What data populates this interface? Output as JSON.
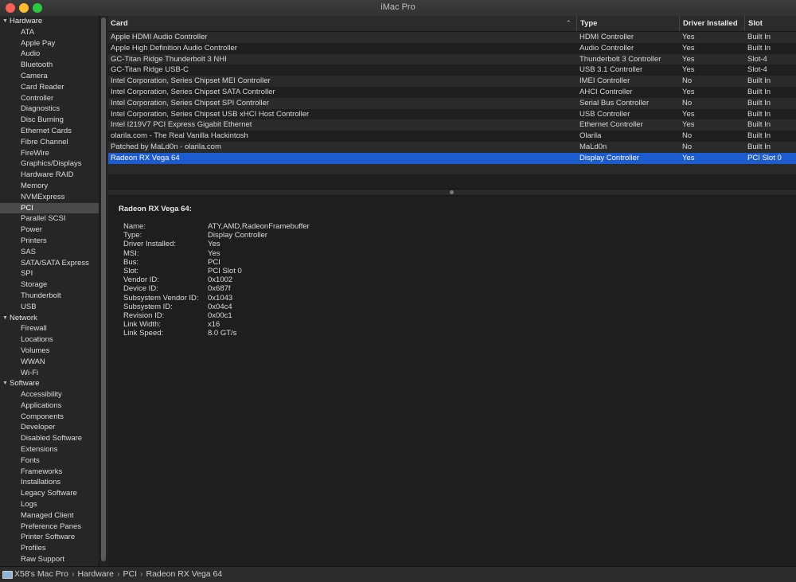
{
  "window": {
    "title": "iMac Pro"
  },
  "sidebar": {
    "groups": [
      {
        "label": "Hardware",
        "items": [
          "ATA",
          "Apple Pay",
          "Audio",
          "Bluetooth",
          "Camera",
          "Card Reader",
          "Controller",
          "Diagnostics",
          "Disc Burning",
          "Ethernet Cards",
          "Fibre Channel",
          "FireWire",
          "Graphics/Displays",
          "Hardware RAID",
          "Memory",
          "NVMExpress",
          "PCI",
          "Parallel SCSI",
          "Power",
          "Printers",
          "SAS",
          "SATA/SATA Express",
          "SPI",
          "Storage",
          "Thunderbolt",
          "USB"
        ]
      },
      {
        "label": "Network",
        "items": [
          "Firewall",
          "Locations",
          "Volumes",
          "WWAN",
          "Wi-Fi"
        ]
      },
      {
        "label": "Software",
        "items": [
          "Accessibility",
          "Applications",
          "Components",
          "Developer",
          "Disabled Software",
          "Extensions",
          "Fonts",
          "Frameworks",
          "Installations",
          "Legacy Software",
          "Logs",
          "Managed Client",
          "Preference Panes",
          "Printer Software",
          "Profiles",
          "Raw Support"
        ]
      }
    ],
    "selected": "PCI"
  },
  "table": {
    "columns": [
      "Card",
      "Type",
      "Driver Installed",
      "Slot"
    ],
    "sort_indicator": "⌃",
    "rows": [
      [
        "Apple HDMI Audio Controller",
        "HDMI Controller",
        "Yes",
        "Built In"
      ],
      [
        "Apple High Definition Audio Controller",
        "Audio Controller",
        "Yes",
        "Built In"
      ],
      [
        "GC-Titan Ridge Thunderbolt 3 NHI",
        "Thunderbolt 3 Controller",
        "Yes",
        "Slot-4"
      ],
      [
        "GC-Titan Ridge USB-C",
        "USB 3.1 Controller",
        "Yes",
        "Slot-4"
      ],
      [
        "Intel Corporation, Series Chipset MEI Controller",
        "IMEI Controller",
        "No",
        "Built In"
      ],
      [
        "Intel Corporation, Series Chipset SATA Controller",
        "AHCI Controller",
        "Yes",
        "Built In"
      ],
      [
        "Intel Corporation, Series Chipset SPI Controller",
        "Serial Bus Controller",
        "No",
        "Built In"
      ],
      [
        "Intel Corporation, Series Chipset USB xHCI Host Controller",
        "USB Controller",
        "Yes",
        "Built In"
      ],
      [
        "Intel I219V7 PCI Express Gigabit Ethernet",
        "Ethernet Controller",
        "Yes",
        "Built In"
      ],
      [
        "olarila.com - The Real Vanilla Hackintosh",
        "Olarila",
        "No",
        "Built In"
      ],
      [
        "Patched by MaLd0n - olarila.com",
        "MaLd0n",
        "No",
        "Built In"
      ],
      [
        "Radeon RX Vega 64",
        "Display Controller",
        "Yes",
        "PCI Slot 0"
      ]
    ],
    "selected_index": 11
  },
  "detail": {
    "title": "Radeon RX Vega 64:",
    "properties": [
      [
        "Name:",
        "ATY,AMD,RadeonFramebuffer"
      ],
      [
        "Type:",
        "Display Controller"
      ],
      [
        "Driver Installed:",
        "Yes"
      ],
      [
        "MSI:",
        "Yes"
      ],
      [
        "Bus:",
        "PCI"
      ],
      [
        "Slot:",
        "PCI Slot 0"
      ],
      [
        "Vendor ID:",
        "0x1002"
      ],
      [
        "Device ID:",
        "0x687f"
      ],
      [
        "Subsystem Vendor ID:",
        "0x1043"
      ],
      [
        "Subsystem ID:",
        "0x04c4"
      ],
      [
        "Revision ID:",
        "0x00c1"
      ],
      [
        "Link Width:",
        "x16"
      ],
      [
        "Link Speed:",
        "8.0 GT/s"
      ]
    ]
  },
  "statusbar": {
    "breadcrumbs": [
      "X58's Mac Pro",
      "Hardware",
      "PCI",
      "Radeon RX Vega 64"
    ],
    "separator": "›"
  },
  "colors": {
    "selection": "#1d5bd0",
    "sidebar_selection": "#4a4a4a"
  },
  "icons": {
    "computer": "computer-icon",
    "disclosure": "disclosure-triangle-icon"
  }
}
